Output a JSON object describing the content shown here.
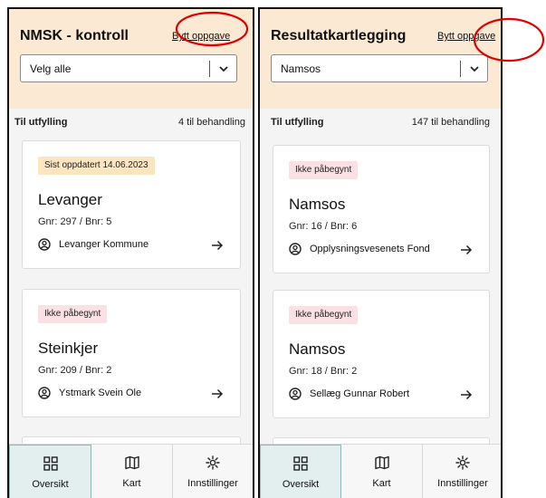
{
  "panels": [
    {
      "title": "NMSK - kontroll",
      "switch_label": "Bytt oppgave",
      "select_value": "Velg alle",
      "list_label": "Til utfylling",
      "list_count": "4 til behandling",
      "cards": [
        {
          "badge": "Sist oppdatert 14.06.2023",
          "badge_type": "updated",
          "title": "Levanger",
          "sub": "Gnr: 297 / Bnr: 5",
          "owner": "Levanger Kommune"
        },
        {
          "badge": "Ikke påbegynt",
          "badge_type": "notstarted",
          "title": "Steinkjer",
          "sub": "Gnr: 209 / Bnr: 2",
          "owner": "Ystmark Svein Ole"
        }
      ]
    },
    {
      "title": "Resultatkartlegging",
      "switch_label": "Bytt oppgave",
      "select_value": "Namsos",
      "list_label": "Til utfylling",
      "list_count": "147 til behandling",
      "cards": [
        {
          "badge": "Ikke påbegynt",
          "badge_type": "notstarted",
          "title": "Namsos",
          "sub": "Gnr: 16 / Bnr: 6",
          "owner": "Opplysningsvesenets Fond"
        },
        {
          "badge": "Ikke påbegynt",
          "badge_type": "notstarted",
          "title": "Namsos",
          "sub": "Gnr: 18 / Bnr: 2",
          "owner": "Sellæg Gunnar Robert"
        }
      ]
    }
  ],
  "nav": {
    "items": [
      {
        "label": "Oversikt",
        "icon": "grid-icon",
        "active": true
      },
      {
        "label": "Kart",
        "icon": "map-icon",
        "active": false
      },
      {
        "label": "Innstillinger",
        "icon": "gear-icon",
        "active": false
      }
    ]
  },
  "colors": {
    "header_bg": "#fbe9d3",
    "badge_updated": "#fbe5bf",
    "badge_not_started": "#fbe1e6",
    "nav_active": "#e3efef",
    "annotation": "#e00000"
  }
}
